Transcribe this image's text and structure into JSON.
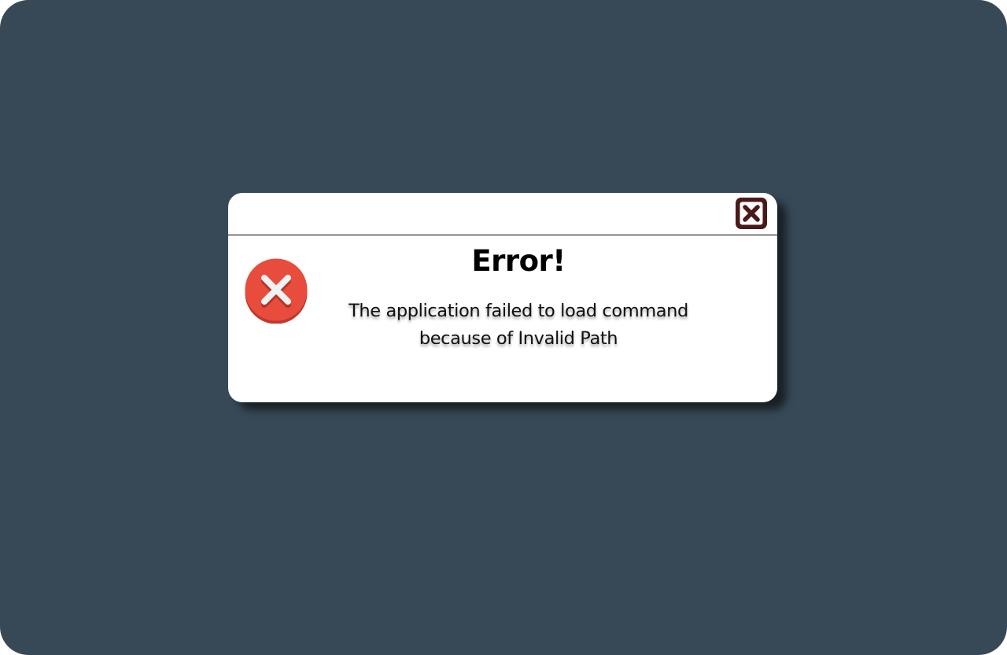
{
  "dialog": {
    "title": "Error!",
    "message_lines": [
      "The application failed to load command",
      "because of Invalid Path"
    ]
  },
  "icons": {
    "status": "error-circle-x-icon",
    "close": "close-box-icon"
  },
  "colors": {
    "background": "#374957",
    "dialog": "#ffffff",
    "error_red": "#e84c3d",
    "close_button": "#4a1a1a"
  }
}
